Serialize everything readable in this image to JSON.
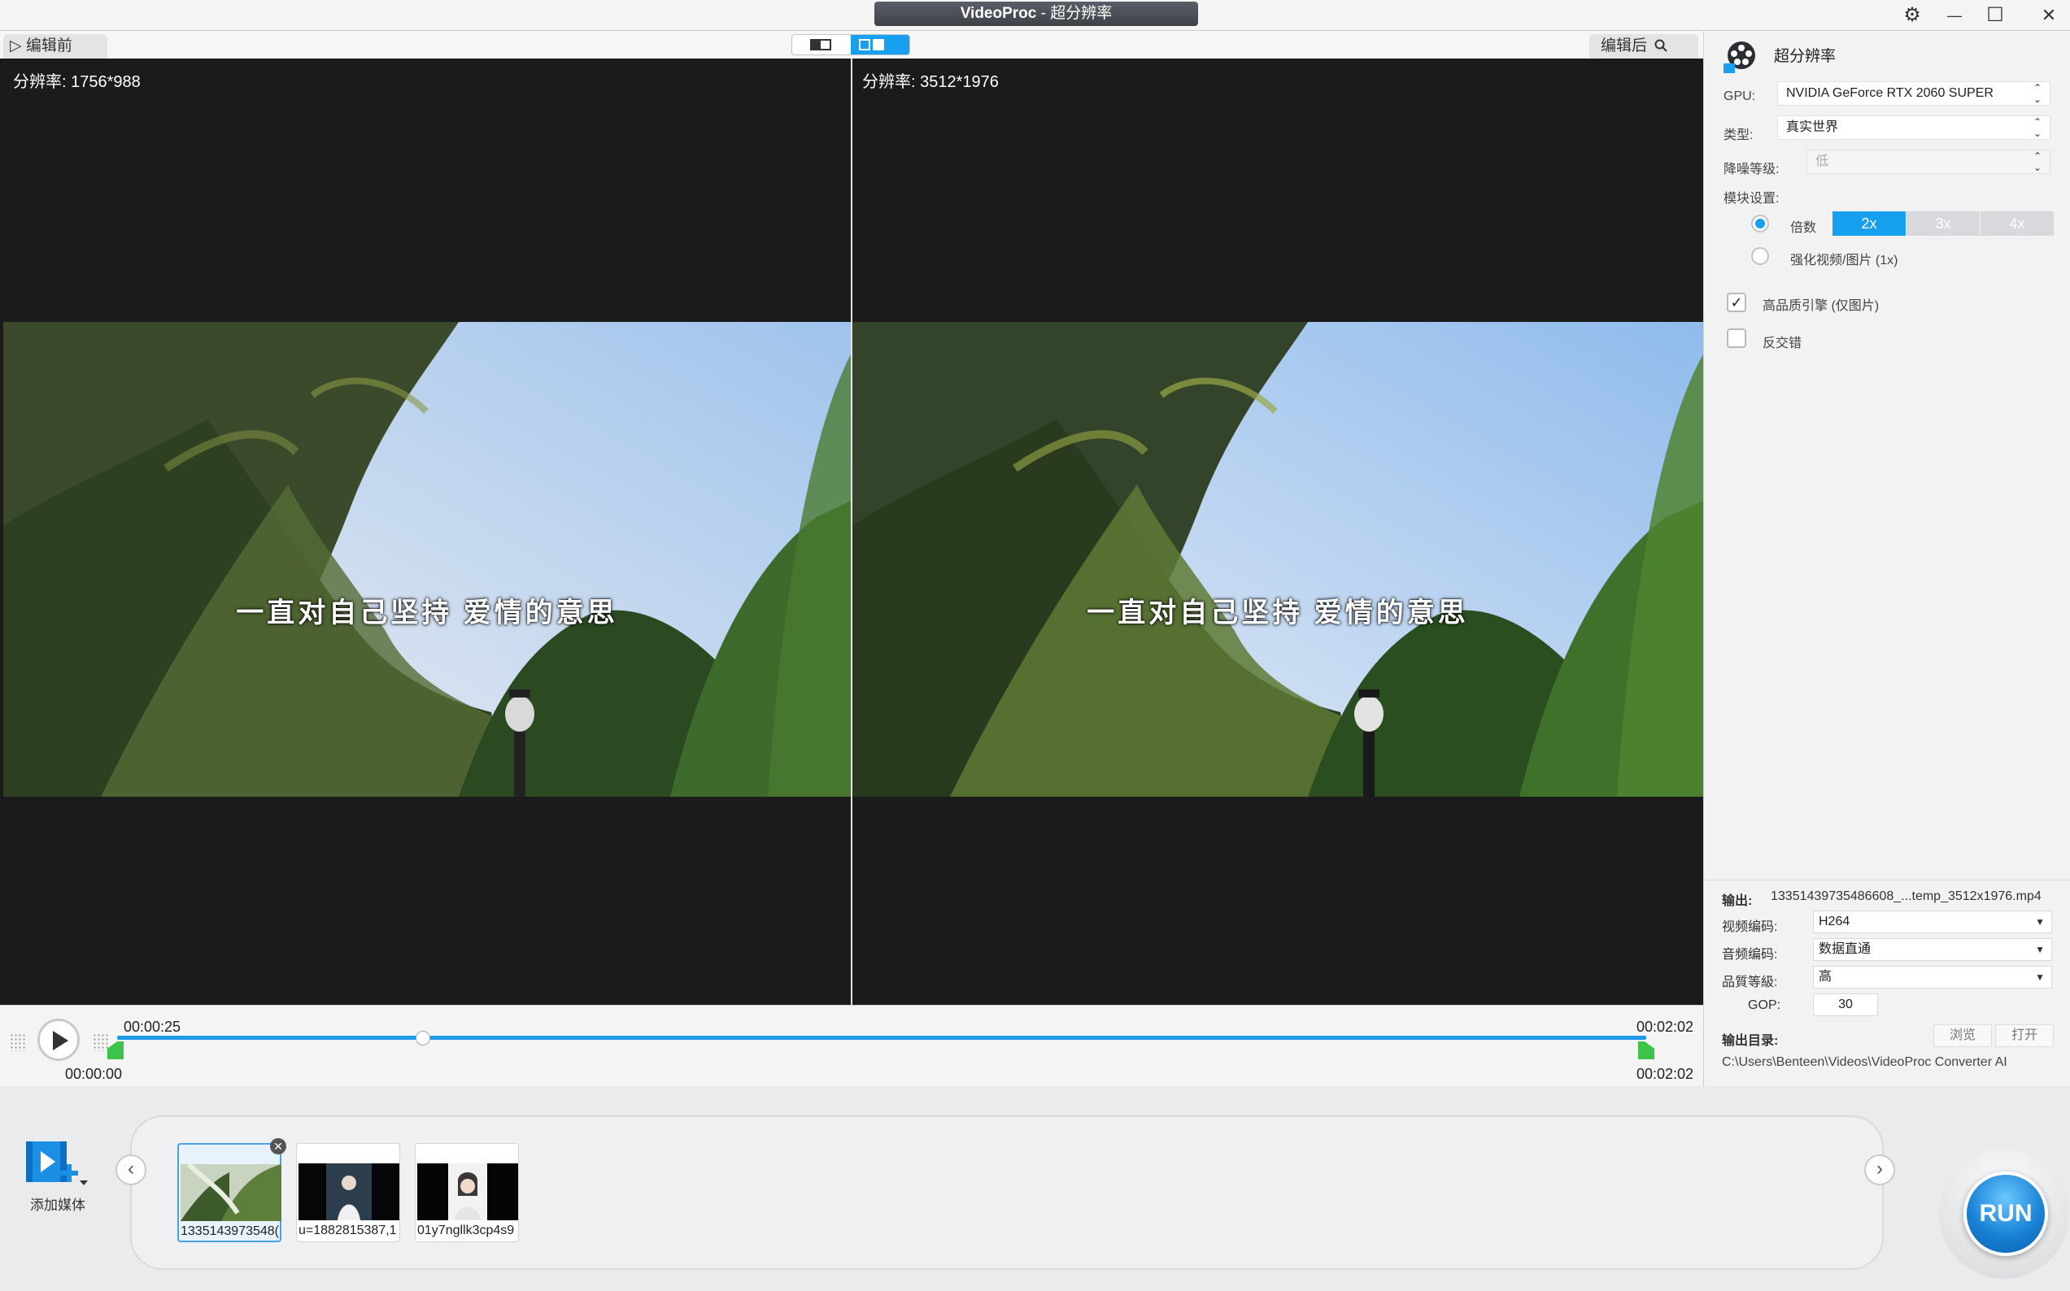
{
  "window": {
    "app_name": "VideoProc",
    "title_sep": " - ",
    "title_module": "超分辨率",
    "settings_glyph": "⚙",
    "minimize_glyph": "—",
    "maximize_glyph": "☐",
    "close_glyph": "✕"
  },
  "preview": {
    "before_tab": "▷ 编辑前",
    "after_tab": "编辑后",
    "left_resolution": "分辨率: 1756*988",
    "right_resolution": "分辨率: 3512*1976",
    "subtitle": "一直对自己坚持 爱情的意思",
    "view_mode_active": "side-by-side"
  },
  "timeline": {
    "current_time": "00:00:25",
    "start_time": "00:00:00",
    "end_time_top": "00:02:02",
    "end_time_bottom": "00:02:02",
    "progress_fraction": 0.2
  },
  "media": {
    "add_label": "添加媒体",
    "prev": "‹",
    "next": "›",
    "items": [
      {
        "label": "1335143973548(",
        "selected": true
      },
      {
        "label": "u=1882815387,1",
        "selected": false
      },
      {
        "label": "01y7ngllk3cp4s9",
        "selected": false
      }
    ],
    "close_glyph": "✕"
  },
  "run_label": "RUN",
  "panel": {
    "title": "超分辨率",
    "gpu_label": "GPU:",
    "gpu_value": "NVIDIA GeForce RTX 2060 SUPER",
    "type_label": "类型:",
    "type_value": "真实世界",
    "denoise_label": "降噪等级:",
    "denoise_value": "低",
    "model_label": "模块设置:",
    "scale_label": "倍数",
    "scale_options": [
      "2x",
      "3x",
      "4x"
    ],
    "scale_selected": "2x",
    "enhance_label": "强化视频/图片 (1x)",
    "hq_label": "高品质引擎 (仅图片)",
    "hq_checked": true,
    "deinterlace_label": "反交错",
    "deinterlace_checked": false,
    "check_glyph": "✓"
  },
  "output": {
    "output_label": "输出:",
    "output_file": "13351439735486608_...temp_3512x1976.mp4",
    "vcodec_label": "视频编码:",
    "vcodec_value": "H264",
    "acodec_label": "音频编码:",
    "acodec_value": "数据直通",
    "quality_label": "品質等級:",
    "quality_value": "高",
    "gop_label": "GOP:",
    "gop_value": "30",
    "dir_label": "输出目录:",
    "browse": "浏览",
    "open": "打开",
    "dir_path": "C:\\Users\\Benteen\\Videos\\VideoProc Converter AI"
  },
  "colors": {
    "accent": "#18a0f0",
    "trim_handle": "#3cc34a"
  }
}
